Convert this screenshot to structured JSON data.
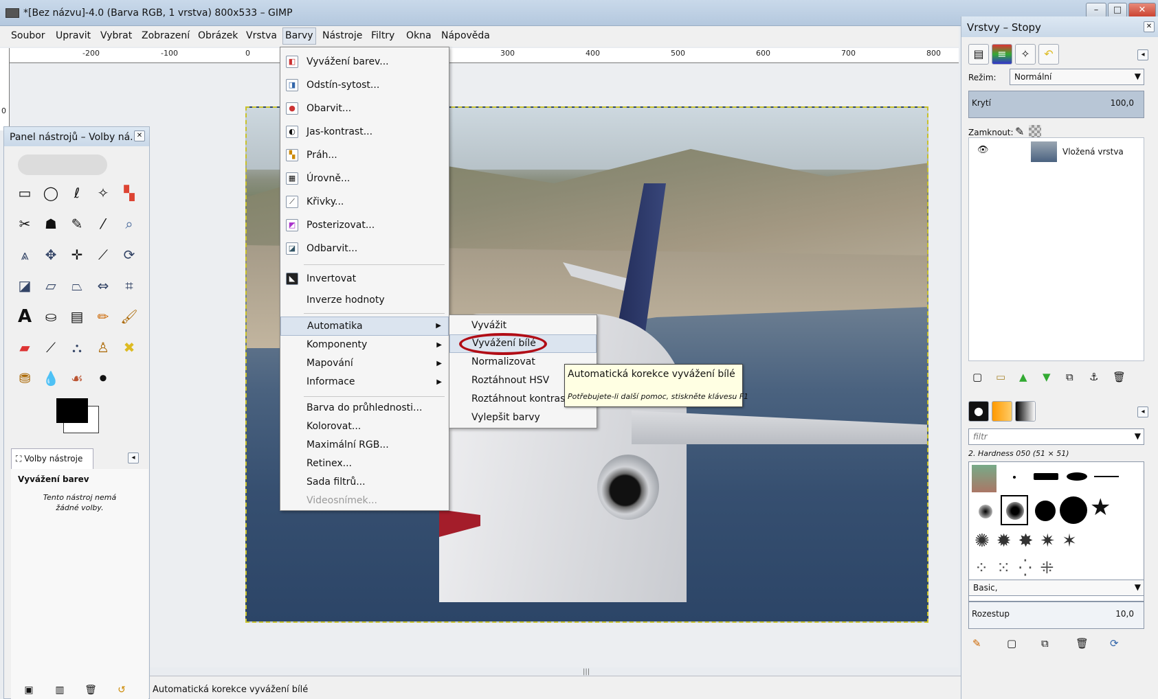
{
  "window": {
    "title": "*[Bez názvu]-4.0 (Barva RGB, 1 vrstva) 800x533 – GIMP"
  },
  "menubar": [
    "Soubor",
    "Upravit",
    "Vybrat",
    "Zobrazení",
    "Obrázek",
    "Vrstva",
    "Barvy",
    "Nástroje",
    "Filtry",
    "Okna",
    "Nápověda"
  ],
  "ruler": {
    "top": [
      "-200",
      "-100",
      "0",
      "300",
      "400",
      "500",
      "600",
      "700",
      "800"
    ],
    "left": [
      "0"
    ]
  },
  "barvy_menu": {
    "items": [
      "Vyvážení barev...",
      "Odstín-sytost...",
      "Obarvit...",
      "Jas-kontrast...",
      "Práh...",
      "Úrovně...",
      "Křivky...",
      "Posterizovat...",
      "Odbarvit..."
    ],
    "items2": [
      "Invertovat",
      "Inverze hodnoty"
    ],
    "submenus": [
      "Automatika",
      "Komponenty",
      "Mapování",
      "Informace"
    ],
    "items3": [
      "Barva do průhlednosti...",
      "Kolorovat...",
      "Maximální RGB...",
      "Retinex...",
      "Sada filtrů...",
      "Videosnímek..."
    ]
  },
  "automatika_menu": [
    "Vyvážit",
    "Vyvážení bílé",
    "Normalizovat",
    "Roztáhnout HSV",
    "Roztáhnout kontrast",
    "Vylepšit barvy"
  ],
  "tooltip": {
    "title": "Automatická korekce vyvážení bílé",
    "help": "Potřebujete-li další pomoc, stiskněte klávesu F1"
  },
  "toolbox": {
    "title": "Panel nástrojů – Volby ná...",
    "options_tab": "Volby nástroje",
    "options_title": "Vyvážení barev",
    "options_note": "Tento nástroj nemá žádné volby."
  },
  "dock": {
    "title": "Vrstvy – Stopy",
    "mode_label": "Režim:",
    "mode_value": "Normální",
    "opacity_label": "Krytí",
    "opacity_value": "100,0",
    "lock_label": "Zamknout:",
    "layer_name": "Vložená vrstva",
    "filter_placeholder": "filtr",
    "brush_name": "2. Hardness 050 (51 × 51)",
    "brush_set": "Basic,",
    "spacing_label": "Rozestup",
    "spacing_value": "10,0"
  },
  "statusbar": {
    "text": "Automatická korekce vyvážení bílé"
  },
  "colors": {
    "accent_red": "#b10d16",
    "menu_highlight": "#dbe4ef",
    "tooltip_bg": "#ffffe3"
  }
}
